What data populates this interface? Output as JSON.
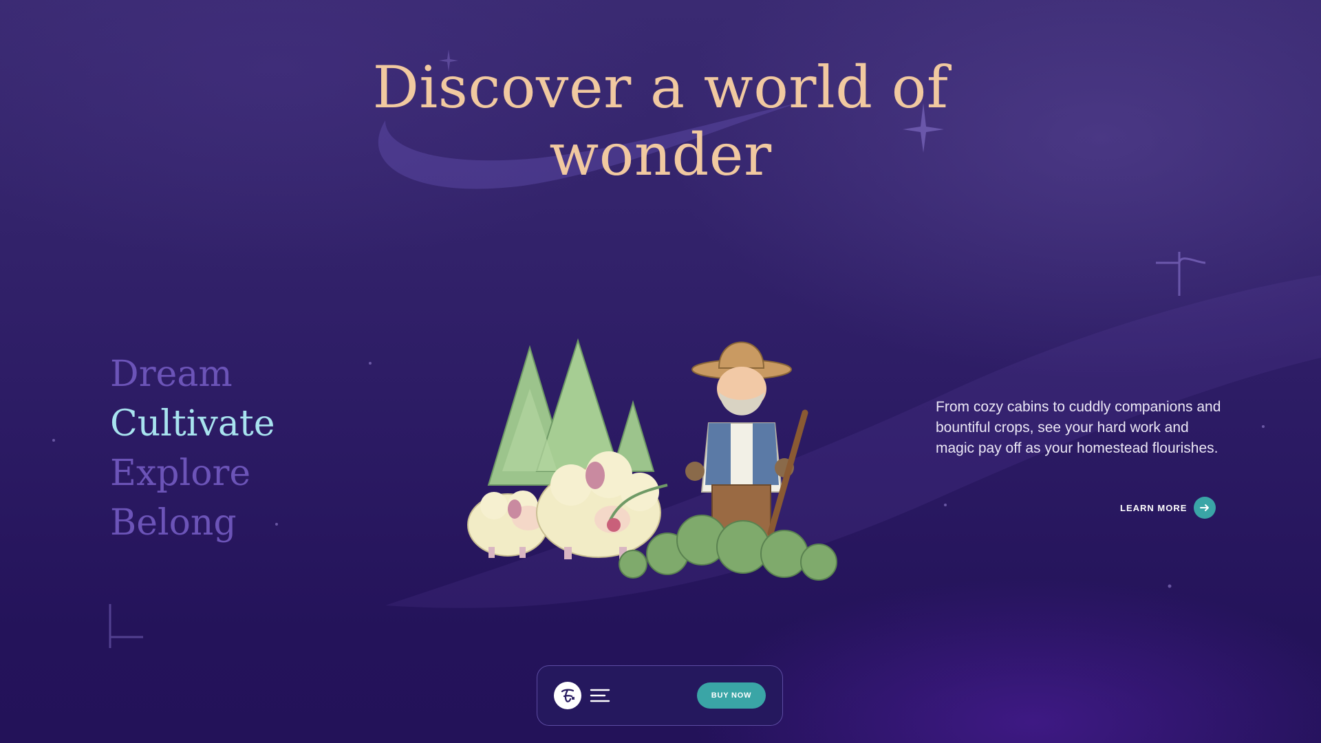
{
  "hero": {
    "title": "Discover a world of wonder"
  },
  "nav_words": {
    "items": [
      {
        "label": "Dream",
        "active": false
      },
      {
        "label": "Cultivate",
        "active": true
      },
      {
        "label": "Explore",
        "active": false
      },
      {
        "label": "Belong",
        "active": false
      }
    ]
  },
  "feature": {
    "description": "From cozy cabins to cuddly companions and bountiful crops, see your hard work and magic pay off as your homestead flourishes.",
    "learn_more_label": "LEARN MORE",
    "learn_more_icon": "arrow-right-icon"
  },
  "bottom_bar": {
    "logo_icon": "game-logo-icon",
    "menu_icon": "hamburger-menu-icon",
    "buy_label": "BUY NOW"
  },
  "colors": {
    "title": "#f1c9a0",
    "nav_inactive": "#6c54b8",
    "nav_active": "#a8e3ef",
    "accent": "#3aa5a6",
    "bar_bg": "#25185e"
  }
}
